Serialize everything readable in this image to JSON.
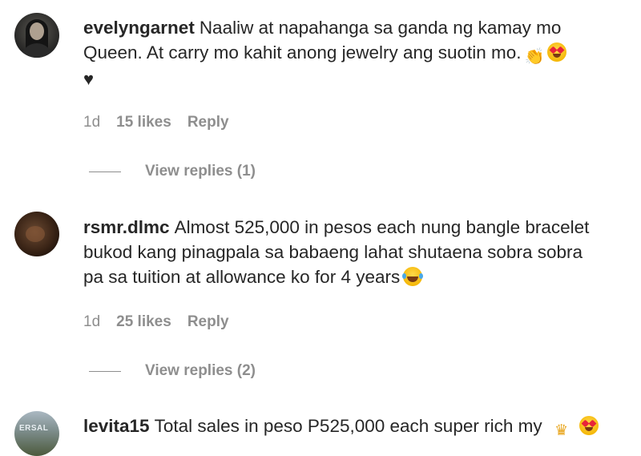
{
  "comments": [
    {
      "username": "evelyngarnet",
      "text_line1": "Naaliw at napahanga sa ganda ng kamay mo",
      "text_line2": "Queen. At carry mo kahit anong jewelry ang suotin mo.",
      "time": "1d",
      "likes": "15 likes",
      "reply_label": "Reply",
      "view_replies": "View replies (1)",
      "emojis": [
        "clapping-hands",
        "heart-eyes",
        "black-heart"
      ]
    },
    {
      "username": "rsmr.dlmc",
      "text_line1": "Almost 525,000 in pesos each nung bangle bracelet",
      "text_line2": "bukod kang pinagpala sa babaeng lahat shutaena sobra sobra",
      "text_line3": "pa sa tuition at allowance ko for 4 years",
      "time": "1d",
      "likes": "25 likes",
      "reply_label": "Reply",
      "view_replies": "View replies (2)",
      "emojis": [
        "tears-of-joy"
      ]
    },
    {
      "username": "levita15",
      "text_line1": "Total sales in peso P525,000 each super rich my",
      "avatar_text": "ERSAL",
      "emojis": [
        "crown",
        "heart-eyes"
      ]
    }
  ],
  "colors": {
    "text": "#262626",
    "secondary": "#8e8e8e",
    "background": "#ffffff"
  }
}
